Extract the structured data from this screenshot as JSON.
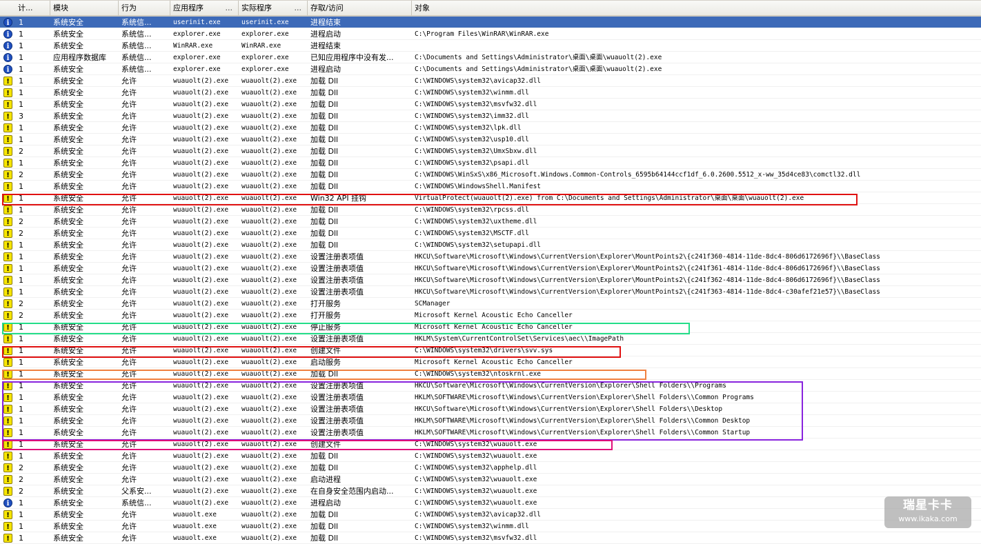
{
  "columns": [
    {
      "label": "计..."
    },
    {
      "label": "模块"
    },
    {
      "label": "行为"
    },
    {
      "label": "应用程序",
      "dots": "..."
    },
    {
      "label": "实际程序",
      "dots": "..."
    },
    {
      "label": "存取/访问"
    },
    {
      "label": "对象"
    }
  ],
  "rows": [
    {
      "icon": "info",
      "count": "1",
      "module": "系统安全",
      "action": "系统信...",
      "app": "userinit.exe",
      "real": "userinit.exe",
      "access": "进程结束",
      "object": "",
      "selected": true
    },
    {
      "icon": "info",
      "count": "1",
      "module": "系统安全",
      "action": "系统信...",
      "app": "explorer.exe",
      "real": "explorer.exe",
      "access": "进程启动",
      "object": "C:\\Program Files\\WinRAR\\WinRAR.exe"
    },
    {
      "icon": "info",
      "count": "1",
      "module": "系统安全",
      "action": "系统信...",
      "app": "WinRAR.exe",
      "real": "WinRAR.exe",
      "access": "进程结束",
      "object": ""
    },
    {
      "icon": "info",
      "count": "1",
      "module": "应用程序数据库",
      "action": "系统信...",
      "app": "explorer.exe",
      "real": "explorer.exe",
      "access": "已知应用程序中没有发...",
      "object": "C:\\Documents and Settings\\Administrator\\桌面\\桌面\\wuauolt(2).exe"
    },
    {
      "icon": "info",
      "count": "1",
      "module": "系统安全",
      "action": "系统信...",
      "app": "explorer.exe",
      "real": "explorer.exe",
      "access": "进程启动",
      "object": "C:\\Documents and Settings\\Administrator\\桌面\\桌面\\wuauolt(2).exe"
    },
    {
      "icon": "warn",
      "count": "1",
      "module": "系统安全",
      "action": "允许",
      "app": "wuauolt(2).exe",
      "real": "wuauolt(2).exe",
      "access": "加载 Dll",
      "object": "C:\\WINDOWS\\system32\\avicap32.dll"
    },
    {
      "icon": "warn",
      "count": "1",
      "module": "系统安全",
      "action": "允许",
      "app": "wuauolt(2).exe",
      "real": "wuauolt(2).exe",
      "access": "加载 Dll",
      "object": "C:\\WINDOWS\\system32\\winmm.dll"
    },
    {
      "icon": "warn",
      "count": "1",
      "module": "系统安全",
      "action": "允许",
      "app": "wuauolt(2).exe",
      "real": "wuauolt(2).exe",
      "access": "加载 Dll",
      "object": "C:\\WINDOWS\\system32\\msvfw32.dll"
    },
    {
      "icon": "warn",
      "count": "3",
      "module": "系统安全",
      "action": "允许",
      "app": "wuauolt(2).exe",
      "real": "wuauolt(2).exe",
      "access": "加载 Dll",
      "object": "C:\\WINDOWS\\system32\\imm32.dll"
    },
    {
      "icon": "warn",
      "count": "1",
      "module": "系统安全",
      "action": "允许",
      "app": "wuauolt(2).exe",
      "real": "wuauolt(2).exe",
      "access": "加载 Dll",
      "object": "C:\\WINDOWS\\system32\\lpk.dll"
    },
    {
      "icon": "warn",
      "count": "1",
      "module": "系统安全",
      "action": "允许",
      "app": "wuauolt(2).exe",
      "real": "wuauolt(2).exe",
      "access": "加载 Dll",
      "object": "C:\\WINDOWS\\system32\\usp10.dll"
    },
    {
      "icon": "warn",
      "count": "2",
      "module": "系统安全",
      "action": "允许",
      "app": "wuauolt(2).exe",
      "real": "wuauolt(2).exe",
      "access": "加载 Dll",
      "object": "C:\\WINDOWS\\system32\\UmxSbxw.dll"
    },
    {
      "icon": "warn",
      "count": "1",
      "module": "系统安全",
      "action": "允许",
      "app": "wuauolt(2).exe",
      "real": "wuauolt(2).exe",
      "access": "加载 Dll",
      "object": "C:\\WINDOWS\\system32\\psapi.dll"
    },
    {
      "icon": "warn",
      "count": "2",
      "module": "系统安全",
      "action": "允许",
      "app": "wuauolt(2).exe",
      "real": "wuauolt(2).exe",
      "access": "加载 Dll",
      "object": "C:\\WINDOWS\\WinSxS\\x86_Microsoft.Windows.Common-Controls_6595b64144ccf1df_6.0.2600.5512_x-ww_35d4ce83\\comctl32.dll"
    },
    {
      "icon": "warn",
      "count": "1",
      "module": "系统安全",
      "action": "允许",
      "app": "wuauolt(2).exe",
      "real": "wuauolt(2).exe",
      "access": "加载 Dll",
      "object": "C:\\WINDOWS\\WindowsShell.Manifest"
    },
    {
      "icon": "warn",
      "count": "1",
      "module": "系统安全",
      "action": "允许",
      "app": "wuauolt(2).exe",
      "real": "wuauolt(2).exe",
      "access": "Win32 API 挂钩",
      "object": "VirtualProtect(wuauolt(2).exe) from C:\\Documents and Settings\\Administrator\\桌面\\桌面\\wuauolt(2).exe"
    },
    {
      "icon": "warn",
      "count": "1",
      "module": "系统安全",
      "action": "允许",
      "app": "wuauolt(2).exe",
      "real": "wuauolt(2).exe",
      "access": "加载 Dll",
      "object": "C:\\WINDOWS\\system32\\rpcss.dll"
    },
    {
      "icon": "warn",
      "count": "2",
      "module": "系统安全",
      "action": "允许",
      "app": "wuauolt(2).exe",
      "real": "wuauolt(2).exe",
      "access": "加载 Dll",
      "object": "C:\\WINDOWS\\system32\\uxtheme.dll"
    },
    {
      "icon": "warn",
      "count": "2",
      "module": "系统安全",
      "action": "允许",
      "app": "wuauolt(2).exe",
      "real": "wuauolt(2).exe",
      "access": "加载 Dll",
      "object": "C:\\WINDOWS\\system32\\MSCTF.dll"
    },
    {
      "icon": "warn",
      "count": "1",
      "module": "系统安全",
      "action": "允许",
      "app": "wuauolt(2).exe",
      "real": "wuauolt(2).exe",
      "access": "加载 Dll",
      "object": "C:\\WINDOWS\\system32\\setupapi.dll"
    },
    {
      "icon": "warn",
      "count": "1",
      "module": "系统安全",
      "action": "允许",
      "app": "wuauolt(2).exe",
      "real": "wuauolt(2).exe",
      "access": "设置注册表项值",
      "object": "HKCU\\Software\\Microsoft\\Windows\\CurrentVersion\\Explorer\\MountPoints2\\{c241f360-4814-11de-8dc4-806d6172696f}\\\\BaseClass"
    },
    {
      "icon": "warn",
      "count": "1",
      "module": "系统安全",
      "action": "允许",
      "app": "wuauolt(2).exe",
      "real": "wuauolt(2).exe",
      "access": "设置注册表项值",
      "object": "HKCU\\Software\\Microsoft\\Windows\\CurrentVersion\\Explorer\\MountPoints2\\{c241f361-4814-11de-8dc4-806d6172696f}\\\\BaseClass"
    },
    {
      "icon": "warn",
      "count": "1",
      "module": "系统安全",
      "action": "允许",
      "app": "wuauolt(2).exe",
      "real": "wuauolt(2).exe",
      "access": "设置注册表项值",
      "object": "HKCU\\Software\\Microsoft\\Windows\\CurrentVersion\\Explorer\\MountPoints2\\{c241f362-4814-11de-8dc4-806d6172696f}\\\\BaseClass"
    },
    {
      "icon": "warn",
      "count": "1",
      "module": "系统安全",
      "action": "允许",
      "app": "wuauolt(2).exe",
      "real": "wuauolt(2).exe",
      "access": "设置注册表项值",
      "object": "HKCU\\Software\\Microsoft\\Windows\\CurrentVersion\\Explorer\\MountPoints2\\{c241f363-4814-11de-8dc4-c30afef21e57}\\\\BaseClass"
    },
    {
      "icon": "warn",
      "count": "2",
      "module": "系统安全",
      "action": "允许",
      "app": "wuauolt(2).exe",
      "real": "wuauolt(2).exe",
      "access": "打开服务",
      "object": "SCManager"
    },
    {
      "icon": "warn",
      "count": "2",
      "module": "系统安全",
      "action": "允许",
      "app": "wuauolt(2).exe",
      "real": "wuauolt(2).exe",
      "access": "打开服务",
      "object": "Microsoft Kernel Acoustic Echo Canceller"
    },
    {
      "icon": "warn",
      "count": "1",
      "module": "系统安全",
      "action": "允许",
      "app": "wuauolt(2).exe",
      "real": "wuauolt(2).exe",
      "access": "停止服务",
      "object": "Microsoft Kernel Acoustic Echo Canceller"
    },
    {
      "icon": "warn",
      "count": "1",
      "module": "系统安全",
      "action": "允许",
      "app": "wuauolt(2).exe",
      "real": "wuauolt(2).exe",
      "access": "设置注册表项值",
      "object": "HKLM\\System\\CurrentControlSet\\Services\\aec\\\\ImagePath"
    },
    {
      "icon": "warn",
      "count": "1",
      "module": "系统安全",
      "action": "允许",
      "app": "wuauolt(2).exe",
      "real": "wuauolt(2).exe",
      "access": "创建文件",
      "object": "C:\\WINDOWS\\system32\\drivers\\svv.sys"
    },
    {
      "icon": "warn",
      "count": "1",
      "module": "系统安全",
      "action": "允许",
      "app": "wuauolt(2).exe",
      "real": "wuauolt(2).exe",
      "access": "启动服务",
      "object": "Microsoft Kernel Acoustic Echo Canceller"
    },
    {
      "icon": "warn",
      "count": "1",
      "module": "系统安全",
      "action": "允许",
      "app": "wuauolt(2).exe",
      "real": "wuauolt(2).exe",
      "access": "加载 Dll",
      "object": "C:\\WINDOWS\\system32\\ntoskrnl.exe"
    },
    {
      "icon": "warn",
      "count": "1",
      "module": "系统安全",
      "action": "允许",
      "app": "wuauolt(2).exe",
      "real": "wuauolt(2).exe",
      "access": "设置注册表项值",
      "object": "HKCU\\Software\\Microsoft\\Windows\\CurrentVersion\\Explorer\\Shell Folders\\\\Programs"
    },
    {
      "icon": "warn",
      "count": "1",
      "module": "系统安全",
      "action": "允许",
      "app": "wuauolt(2).exe",
      "real": "wuauolt(2).exe",
      "access": "设置注册表项值",
      "object": "HKLM\\SOFTWARE\\Microsoft\\Windows\\CurrentVersion\\Explorer\\Shell Folders\\\\Common Programs"
    },
    {
      "icon": "warn",
      "count": "1",
      "module": "系统安全",
      "action": "允许",
      "app": "wuauolt(2).exe",
      "real": "wuauolt(2).exe",
      "access": "设置注册表项值",
      "object": "HKCU\\Software\\Microsoft\\Windows\\CurrentVersion\\Explorer\\Shell Folders\\\\Desktop"
    },
    {
      "icon": "warn",
      "count": "1",
      "module": "系统安全",
      "action": "允许",
      "app": "wuauolt(2).exe",
      "real": "wuauolt(2).exe",
      "access": "设置注册表项值",
      "object": "HKLM\\SOFTWARE\\Microsoft\\Windows\\CurrentVersion\\Explorer\\Shell Folders\\\\Common Desktop"
    },
    {
      "icon": "warn",
      "count": "1",
      "module": "系统安全",
      "action": "允许",
      "app": "wuauolt(2).exe",
      "real": "wuauolt(2).exe",
      "access": "设置注册表项值",
      "object": "HKLM\\SOFTWARE\\Microsoft\\Windows\\CurrentVersion\\Explorer\\Shell Folders\\\\Common Startup"
    },
    {
      "icon": "warn",
      "count": "1",
      "module": "系统安全",
      "action": "允许",
      "app": "wuauolt(2).exe",
      "real": "wuauolt(2).exe",
      "access": "创建文件",
      "object": "C:\\WINDOWS\\system32\\wuauolt.exe"
    },
    {
      "icon": "warn",
      "count": "1",
      "module": "系统安全",
      "action": "允许",
      "app": "wuauolt(2).exe",
      "real": "wuauolt(2).exe",
      "access": "加载 Dll",
      "object": "C:\\WINDOWS\\system32\\wuauolt.exe"
    },
    {
      "icon": "warn",
      "count": "2",
      "module": "系统安全",
      "action": "允许",
      "app": "wuauolt(2).exe",
      "real": "wuauolt(2).exe",
      "access": "加载 Dll",
      "object": "C:\\WINDOWS\\system32\\apphelp.dll"
    },
    {
      "icon": "warn",
      "count": "2",
      "module": "系统安全",
      "action": "允许",
      "app": "wuauolt(2).exe",
      "real": "wuauolt(2).exe",
      "access": "启动进程",
      "object": "C:\\WINDOWS\\system32\\wuauolt.exe"
    },
    {
      "icon": "warn",
      "count": "2",
      "module": "系统安全",
      "action": "父系安...",
      "app": "wuauolt(2).exe",
      "real": "wuauolt(2).exe",
      "access": "在自身安全范围内启动...",
      "object": "C:\\WINDOWS\\system32\\wuauolt.exe"
    },
    {
      "icon": "info",
      "count": "1",
      "module": "系统安全",
      "action": "系统信...",
      "app": "wuauolt(2).exe",
      "real": "wuauolt(2).exe",
      "access": "进程启动",
      "object": "C:\\WINDOWS\\system32\\wuauolt.exe"
    },
    {
      "icon": "warn",
      "count": "1",
      "module": "系统安全",
      "action": "允许",
      "app": "wuauolt.exe",
      "real": "wuauolt(2).exe",
      "access": "加载 Dll",
      "object": "C:\\WINDOWS\\system32\\avicap32.dll"
    },
    {
      "icon": "warn",
      "count": "1",
      "module": "系统安全",
      "action": "允许",
      "app": "wuauolt.exe",
      "real": "wuauolt(2).exe",
      "access": "加载 Dll",
      "object": "C:\\WINDOWS\\system32\\winmm.dll"
    },
    {
      "icon": "warn",
      "count": "1",
      "module": "系统安全",
      "action": "允许",
      "app": "wuauolt.exe",
      "real": "wuauolt(2).exe",
      "access": "加载 Dll",
      "object": "C:\\WINDOWS\\system32\\msvfw32.dll"
    }
  ],
  "highlights": [
    {
      "color": "#e01010"
    },
    {
      "color": "#22dd88"
    },
    {
      "color": "#e01010"
    },
    {
      "color": "#f08040"
    },
    {
      "color": "#8822dd"
    },
    {
      "color": "#e0107a"
    }
  ],
  "icons": {
    "info": "i",
    "warn": "!"
  },
  "watermark": {
    "line1": "瑞星卡卡",
    "line2": "www.ikaka.com"
  }
}
